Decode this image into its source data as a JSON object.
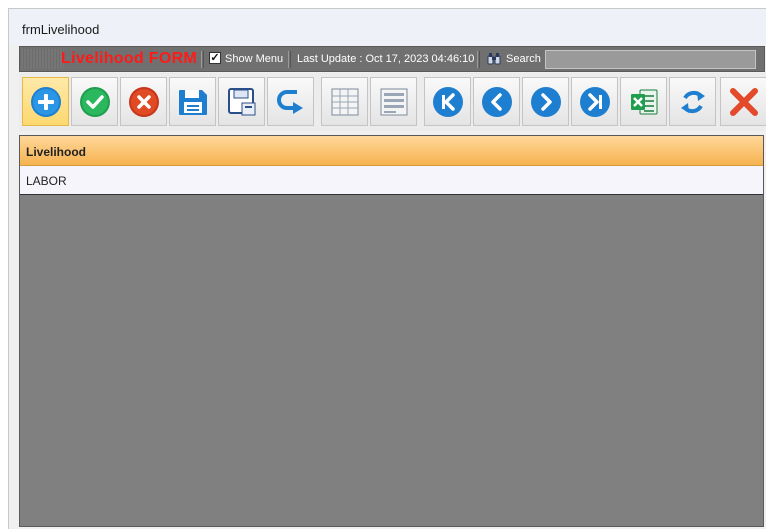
{
  "window": {
    "title": "frmLivelihood"
  },
  "menu": {
    "form_title": "Livelihood  FORM",
    "show_menu_label": "Show Menu",
    "show_menu_checked": true,
    "last_update": "Last Update : Oct 17, 2023 04:46:10",
    "search_label": "Search",
    "search_value": ""
  },
  "toolbar": {
    "buttons": [
      {
        "name": "add-icon",
        "active": true
      },
      {
        "name": "check-icon"
      },
      {
        "name": "cancel-icon"
      },
      {
        "name": "save-icon"
      },
      {
        "name": "save-as-icon"
      },
      {
        "name": "undo-icon"
      },
      {
        "name": "grid-view-icon"
      },
      {
        "name": "form-view-icon"
      },
      {
        "name": "first-record-icon"
      },
      {
        "name": "previous-record-icon"
      },
      {
        "name": "next-record-icon"
      },
      {
        "name": "last-record-icon"
      },
      {
        "name": "excel-export-icon"
      },
      {
        "name": "refresh-icon"
      },
      {
        "name": "close-icon"
      }
    ]
  },
  "grid": {
    "columns": [
      "Livelihood"
    ],
    "rows": [
      [
        "LABOR"
      ]
    ]
  },
  "colors": {
    "form_title": "#ff1a1a",
    "menu_bar": "#707070",
    "header": "#f6b350",
    "grid_bg": "#808080"
  }
}
